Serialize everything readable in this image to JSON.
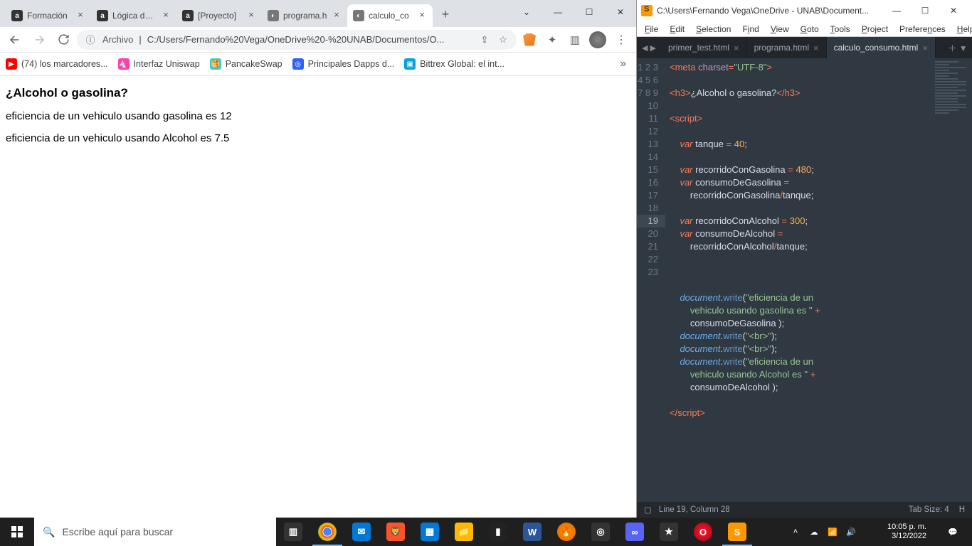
{
  "browser": {
    "tabs": [
      {
        "label": "Formación",
        "favicon": "a",
        "bg": "#333"
      },
      {
        "label": "Lógica de p",
        "favicon": "a",
        "bg": "#333"
      },
      {
        "label": "[Proyecto]",
        "favicon": "a",
        "bg": "#333"
      },
      {
        "label": "programa.h",
        "favicon": "◐",
        "bg": "#777"
      },
      {
        "label": "calculo_co",
        "favicon": "◐",
        "bg": "#777",
        "active": true
      }
    ],
    "address": {
      "prefix": "Archivo",
      "url": "C:/Users/Fernando%20Vega/OneDrive%20-%20UNAB/Documentos/O..."
    },
    "bookmarks": [
      {
        "label": "(74) los marcadores...",
        "icon": "▶",
        "bg": "#f00"
      },
      {
        "label": "Interfaz Uniswap",
        "icon": "🦄",
        "bg": "#ff3db5"
      },
      {
        "label": "PancakeSwap",
        "icon": "🥞",
        "bg": "#3ad0c8"
      },
      {
        "label": "Principales Dapps d...",
        "icon": "◎",
        "bg": "#2962ff"
      },
      {
        "label": "Bittrex Global: el int...",
        "icon": "▣",
        "bg": "#0aa1dd"
      }
    ],
    "page": {
      "heading": "¿Alcohol o gasolina?",
      "line1": "eficiencia de un vehiculo usando gasolina es 12",
      "line2": "eficiencia de un vehiculo usando Alcohol es 7.5"
    }
  },
  "sublime": {
    "title": "C:\\Users\\Fernando Vega\\OneDrive - UNAB\\Document...",
    "menu": [
      "File",
      "Edit",
      "Selection",
      "Find",
      "View",
      "Goto",
      "Tools",
      "Project",
      "Preferences",
      "Help"
    ],
    "tabs": [
      {
        "label": "primer_test.html"
      },
      {
        "label": "programa.html"
      },
      {
        "label": "calculo_consumo.html",
        "active": true
      }
    ],
    "status": {
      "pos": "Line 19, Column 28",
      "tab": "Tab Size: 4",
      "syntax": "H"
    }
  },
  "taskbar": {
    "search_placeholder": "Escribe aquí para buscar",
    "clock": {
      "time": "10:05 p. m.",
      "date": "3/12/2022"
    }
  }
}
